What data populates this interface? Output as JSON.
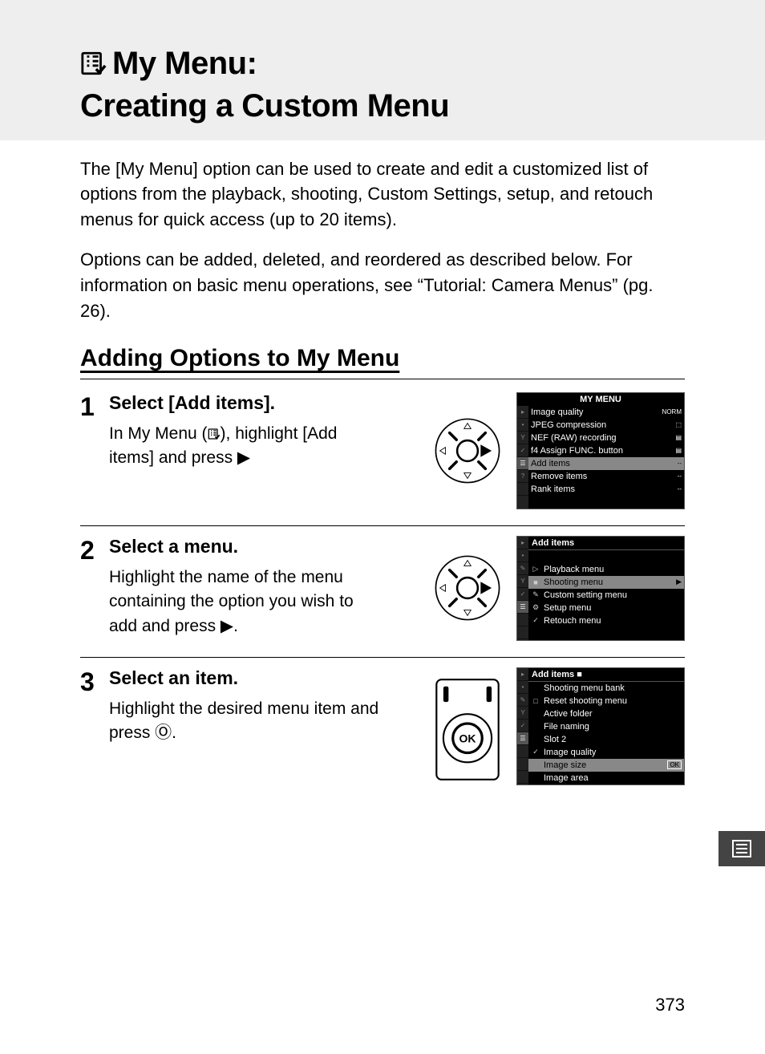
{
  "header": {
    "title_line1": "My Menu:",
    "title_line2": "Creating a Custom Menu"
  },
  "intro1": "The [My Menu] option can be used to create and edit a customized list of options from the playback, shooting, Custom Settings, setup, and retouch menus for quick access (up to 20 items).",
  "intro2": "Options can be added, deleted, and reordered as described below. For information on basic menu operations, see “Tutorial:  Camera Menus” (pg. 26).",
  "section_title": "Adding Options to My Menu",
  "steps": {
    "s1": {
      "num": "1",
      "title": "Select [Add items].",
      "desc_pre": "In My Menu (",
      "desc_post": "), highlight [Add items] and press ▶"
    },
    "s2": {
      "num": "2",
      "title": "Select a menu.",
      "desc": "Highlight the name of the menu containing the option you wish to add and press ▶."
    },
    "s3": {
      "num": "3",
      "title": "Select an item.",
      "desc": "Highlight the desired menu item and press Ⓞ."
    }
  },
  "lcd1": {
    "title": "MY MENU",
    "rows": [
      {
        "label": "Image quality",
        "value": "NORM"
      },
      {
        "label": "JPEG compression",
        "value": "⬚"
      },
      {
        "label": "NEF (RAW) recording",
        "value": "▤"
      },
      {
        "label": "f4 Assign FUNC. button",
        "value": "▤"
      },
      {
        "label": "Add items",
        "value": "--",
        "hl": true
      },
      {
        "label": "Remove items",
        "value": "--"
      },
      {
        "label": "Rank items",
        "value": "--"
      }
    ]
  },
  "lcd2": {
    "title": "Add items",
    "rows": [
      {
        "icon": "▷",
        "label": "Playback menu"
      },
      {
        "icon": "■",
        "label": "Shooting menu",
        "hl": true,
        "arrow": "▶"
      },
      {
        "icon": "✎",
        "label": "Custom setting menu"
      },
      {
        "icon": "⚙",
        "label": "Setup menu"
      },
      {
        "icon": "✓",
        "label": "Retouch menu"
      }
    ]
  },
  "lcd3": {
    "title": "Add items ■",
    "rows": [
      {
        "icon": "",
        "label": "Shooting menu bank"
      },
      {
        "icon": "□",
        "label": "Reset shooting menu"
      },
      {
        "icon": "",
        "label": "Active folder"
      },
      {
        "icon": "",
        "label": "File naming"
      },
      {
        "icon": "",
        "label": "Slot 2"
      },
      {
        "icon": "✓",
        "label": "Image quality"
      },
      {
        "icon": "",
        "label": "Image size",
        "hl": true,
        "ok": "OK"
      },
      {
        "icon": "",
        "label": "Image area"
      }
    ]
  },
  "page_number": "373"
}
